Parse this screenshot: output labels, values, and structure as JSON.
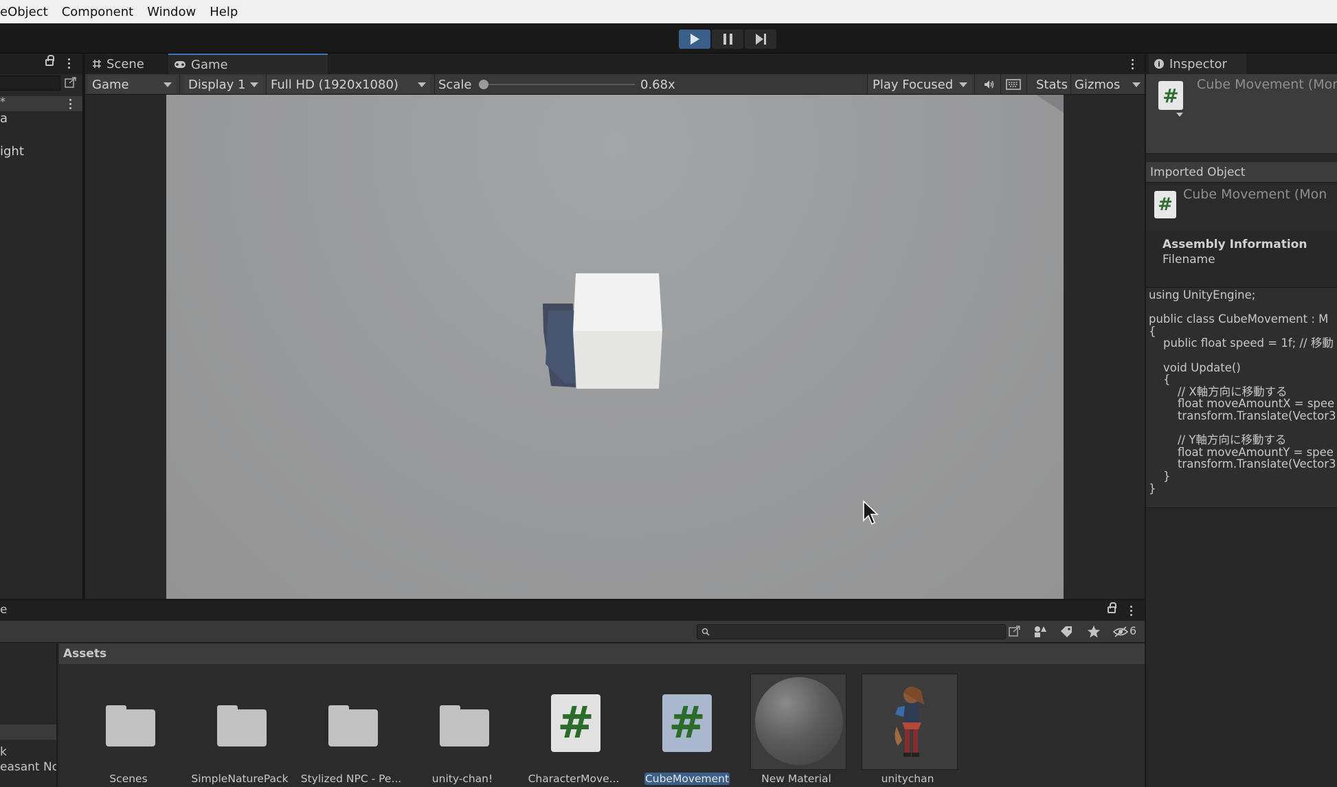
{
  "menu": [
    "eObject",
    "Component",
    "Window",
    "Help"
  ],
  "hierarchy": {
    "scene_marker": "*",
    "rows": [
      "a",
      "ight"
    ]
  },
  "game_view": {
    "tabs": {
      "scene": "Scene",
      "game": "Game"
    },
    "toolbar": {
      "mode": "Game",
      "display": "Display 1",
      "resolution": "Full HD (1920x1080)",
      "scale_label": "Scale",
      "scale_value": "0.68x",
      "play_mode": "Play Focused",
      "stats": "Stats",
      "gizmos": "Gizmos"
    }
  },
  "inspector": {
    "tab": "Inspector",
    "title": "Cube Movement (Mon",
    "imported_label": "Imported Object",
    "imported_title": "Cube Movement (Mon",
    "assembly_heading": "Assembly Information",
    "filename_label": "Filename",
    "code": "using UnityEngine;\n\npublic class CubeMovement : M\n{\n    public float speed = 1f; // 移動\n\n    void Update()\n    {\n        // X軸方向に移動する\n        float moveAmountX = spee\n        transform.Translate(Vector3\n\n        // Y軸方向に移動する\n        float moveAmountY = spee\n        transform.Translate(Vector3\n    }\n}"
  },
  "project": {
    "tab_fragment": "e",
    "hidden_count": "6",
    "breadcrumb": "Assets",
    "left_items": [
      "k",
      "easant No"
    ],
    "assets": [
      {
        "label": "Scenes",
        "kind": "folder"
      },
      {
        "label": "SimpleNaturePack",
        "kind": "folder"
      },
      {
        "label": "Stylized NPC - Pe...",
        "kind": "folder"
      },
      {
        "label": "unity-chan!",
        "kind": "folder"
      },
      {
        "label": "CharacterMove...",
        "kind": "script"
      },
      {
        "label": "CubeMovement",
        "kind": "script-selected"
      },
      {
        "label": "New Material",
        "kind": "material"
      },
      {
        "label": "unitychan",
        "kind": "model"
      }
    ]
  },
  "colors": {
    "accent": "#3a79bb",
    "selection": "#3a5f88",
    "script_hash": "#2b6c2b"
  }
}
